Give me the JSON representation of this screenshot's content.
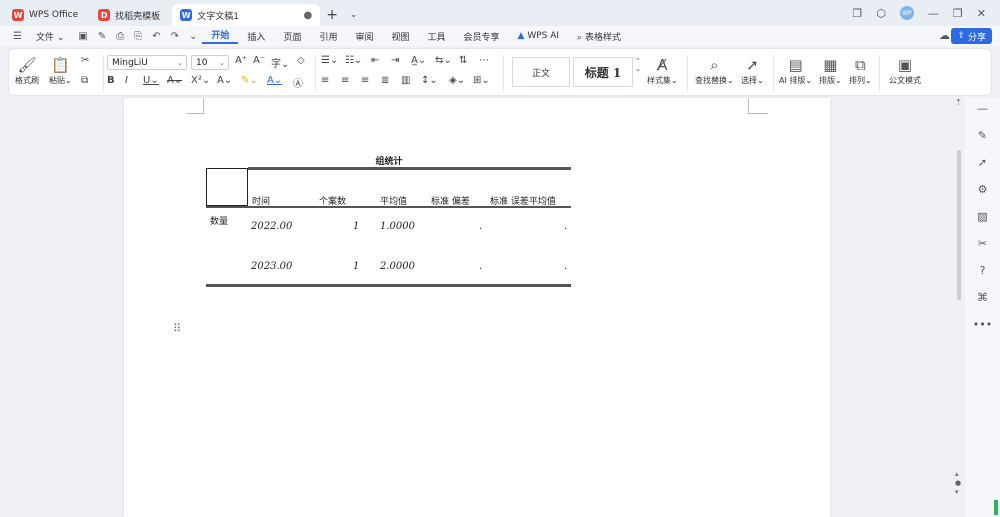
{
  "tabs": [
    {
      "label": "WPS Office",
      "color": "#e8453c"
    },
    {
      "label": "找稻壳模板",
      "color": "#e8453c"
    },
    {
      "label": "文字文稿1",
      "color": "#2f6ae5"
    }
  ],
  "menu": {
    "file": "文件",
    "items": [
      "开始",
      "插入",
      "页面",
      "引用",
      "审阅",
      "视图",
      "工具",
      "会员专享"
    ],
    "active": "开始",
    "wps_ai": "WPS AI",
    "table_style": "表格样式",
    "share": "分享"
  },
  "ribbon": {
    "format_painter": "格式刷",
    "paste": "粘贴",
    "font_name": "MingLiU",
    "font_size": "10",
    "style_normal": "正文",
    "style_heading": "标题 1",
    "style_set": "样式集",
    "find_replace": "查找替换",
    "select": "选择",
    "ai_layout": "AI 排版",
    "layout": "排版",
    "arrange": "排列",
    "official_mode": "公文模式"
  },
  "document": {
    "table_title": "组统计",
    "headers": [
      "时间",
      "个案数",
      "平均值",
      "标准 偏差",
      "标准 误差平均值"
    ],
    "row_label": "数量",
    "rows": [
      {
        "time": "2022.00",
        "n": "1",
        "mean": "1.0000",
        "sd": ".",
        "se": "."
      },
      {
        "time": "2023.00",
        "n": "1",
        "mean": "2.0000",
        "sd": ".",
        "se": "."
      }
    ]
  }
}
